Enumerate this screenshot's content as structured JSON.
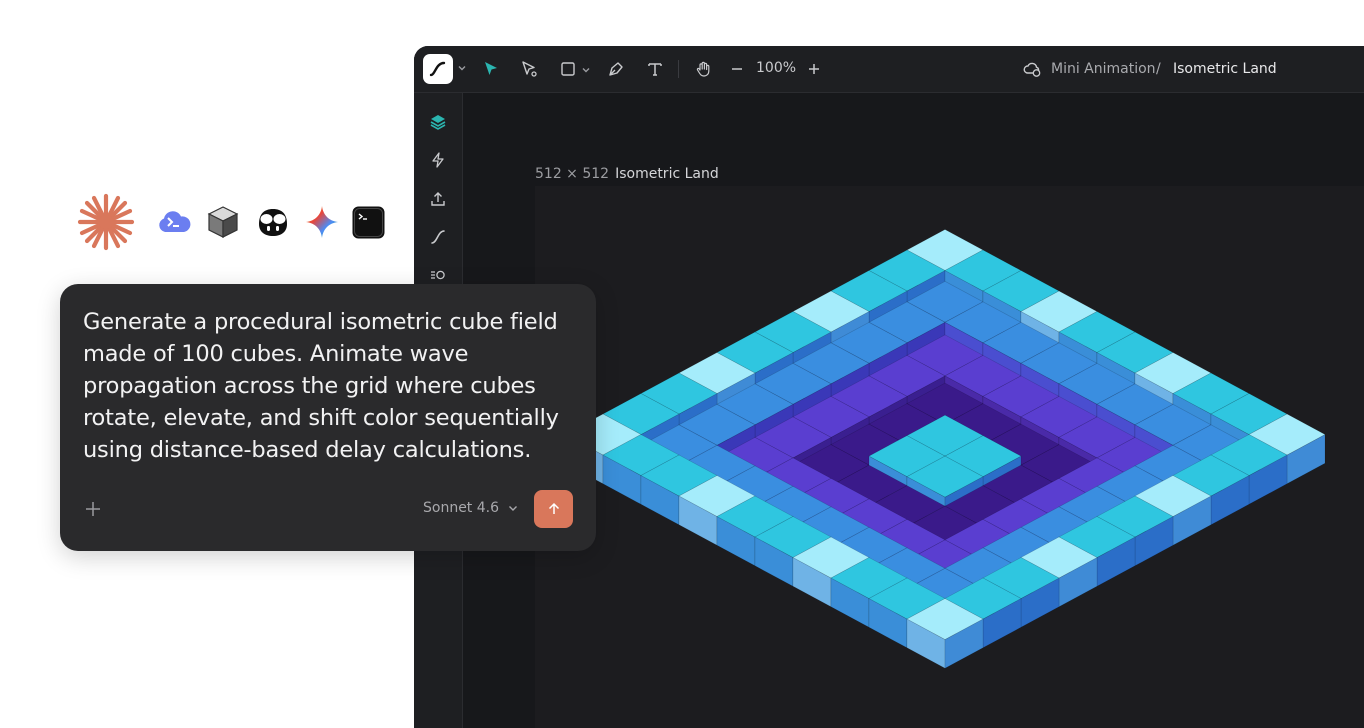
{
  "toolbar": {
    "zoom": "100%",
    "project": "Mini Animation",
    "separator": "/",
    "file": "Isometric Land",
    "tools": [
      "select-arrow-icon",
      "node-select-icon",
      "rectangle-icon",
      "pen-icon",
      "text-icon",
      "hand-icon",
      "zoom-out-icon",
      "zoom-in-icon"
    ]
  },
  "sidebar": {
    "items": [
      "layers-icon",
      "lightning-icon",
      "export-icon",
      "curve-icon",
      "list-toggle-icon"
    ]
  },
  "artboard": {
    "size": "512 × 512",
    "name": "Isometric Land"
  },
  "models": [
    "claude-icon",
    "powershell-cloud-icon",
    "cube-icon",
    "copilot-icon",
    "gemini-icon",
    "terminal-icon"
  ],
  "prompt": {
    "text": "Generate a procedural isometric cube field made of 100 cubes. Animate wave propagation across the grid where cubes rotate, elevate, and shift color sequentially using distance-based delay calculations.",
    "model": "Sonnet 4.6"
  },
  "colors": {
    "accent": "#d9775b",
    "active_tool": "#2bb5b0",
    "cube_light": "#a5ecfb",
    "cube_cyan": "#2fc6e0",
    "cube_blue": "#3a8ee0",
    "cube_purple": "#5a3ed0",
    "cube_deep": "#2a1466"
  }
}
